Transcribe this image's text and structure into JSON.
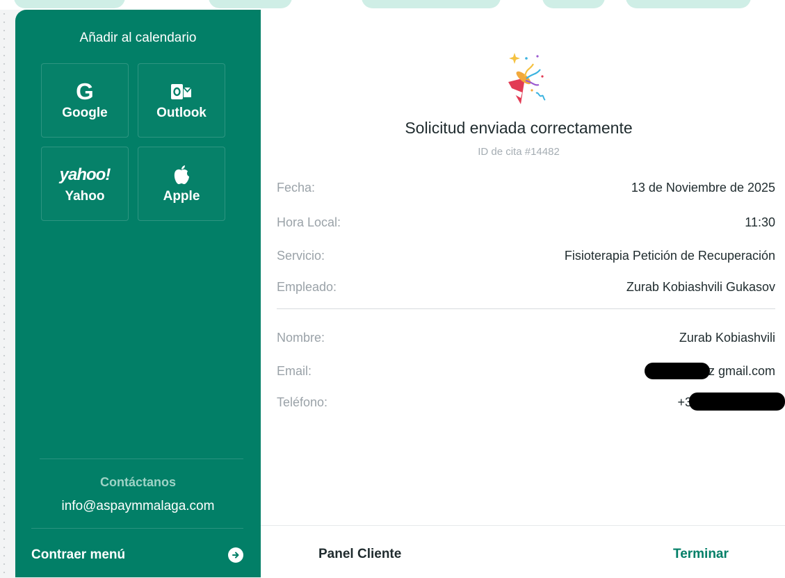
{
  "sidebar": {
    "calendar_title": "Añadir al calendario",
    "calendar_buttons": [
      {
        "label": "Google",
        "icon": "google-icon"
      },
      {
        "label": "Outlook",
        "icon": "outlook-icon"
      },
      {
        "label": "Yahoo",
        "icon": "yahoo-icon",
        "icon_text": "yahoo!"
      },
      {
        "label": "Apple",
        "icon": "apple-icon"
      }
    ],
    "contact_title": "Contáctanos",
    "contact_email": "info@aspaymmalaga.com",
    "collapse_label": "Contraer menú",
    "collapse_icon": "arrow-right-circle-icon"
  },
  "main": {
    "icon": "party-popper-icon",
    "title": "Solicitud enviada correctamente",
    "appointment_id": "ID de cita #14482",
    "details": [
      {
        "key": "Fecha:",
        "value": "13 de Noviembre de 2025"
      },
      {
        "key": "Hora Local:",
        "value": "11:30"
      },
      {
        "key": "Servicio:",
        "value": "Fisioterapia Petición de Recuperación"
      },
      {
        "key": "Empleado:",
        "value": "Zurab Kobiashvili Gukasov"
      }
    ],
    "customer": [
      {
        "key": "Nombre:",
        "value": "Zurab Kobiashvili"
      },
      {
        "key": "Email:",
        "value": "z gmail.com"
      },
      {
        "key": "Teléfono:",
        "value": "+3"
      }
    ]
  },
  "footer": {
    "panel_label": "Panel Cliente",
    "finish_label": "Terminar"
  },
  "colors": {
    "brand_green": "#027f67",
    "text_dark": "#1f2b2e",
    "text_muted": "#9aa2a8"
  }
}
